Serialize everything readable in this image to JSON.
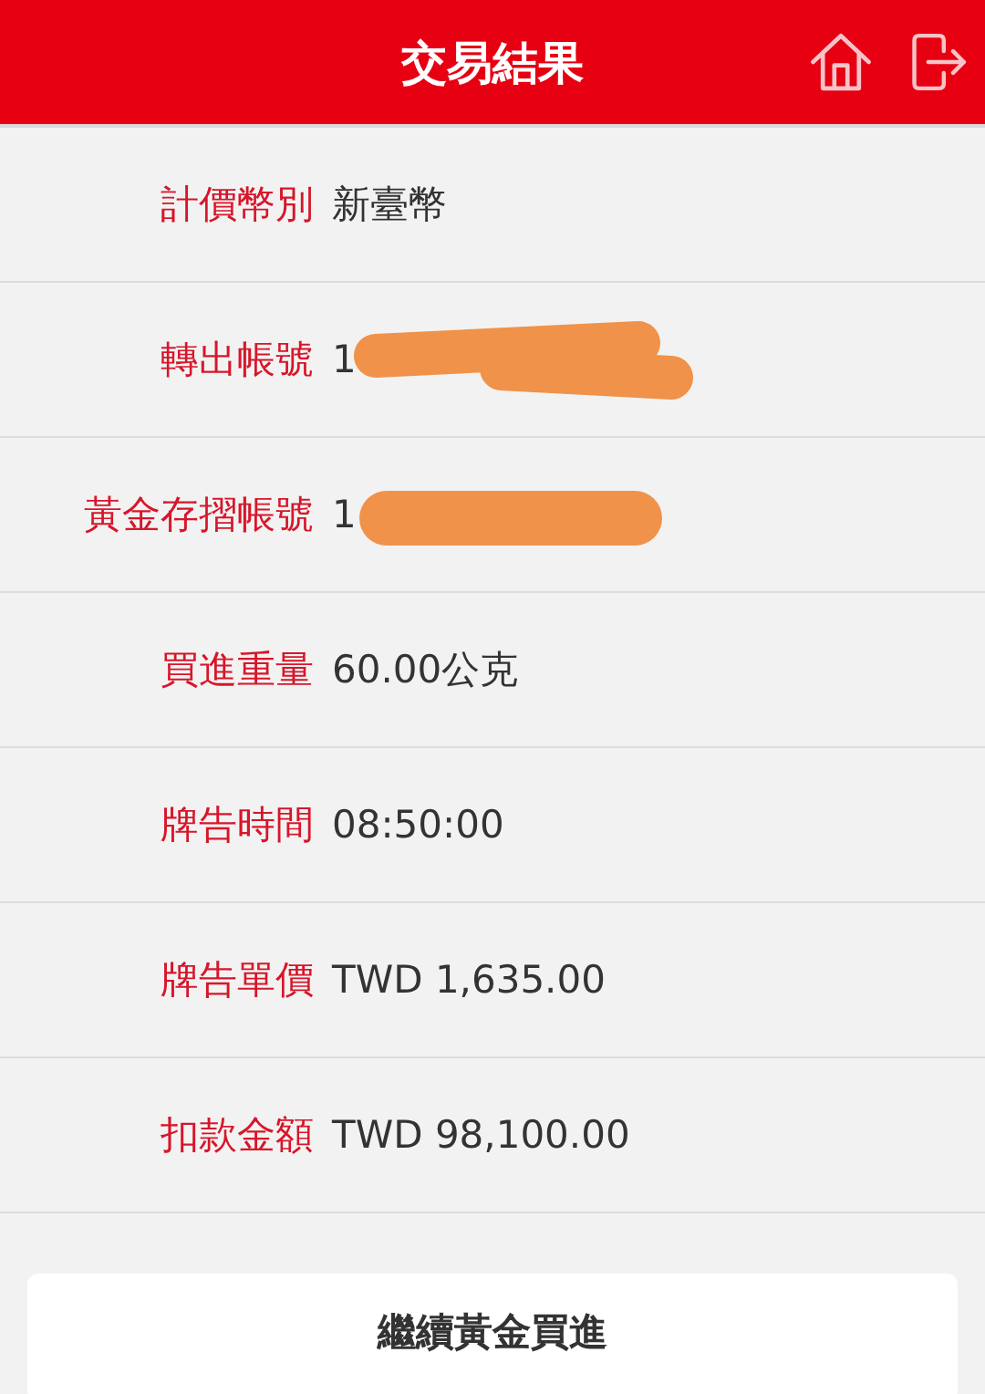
{
  "header": {
    "title": "交易結果"
  },
  "rows": [
    {
      "label": "計價幣別",
      "value": "新臺幣"
    },
    {
      "label": "轉出帳號",
      "value": "1"
    },
    {
      "label": "黃金存摺帳號",
      "value": "1"
    },
    {
      "label": "買進重量",
      "value": "60.00公克"
    },
    {
      "label": "牌告時間",
      "value": "08:50:00"
    },
    {
      "label": "牌告單價",
      "value": "TWD 1,635.00"
    },
    {
      "label": "扣款金額",
      "value": "TWD 98,100.00"
    }
  ],
  "button": "繼續黃金買進"
}
